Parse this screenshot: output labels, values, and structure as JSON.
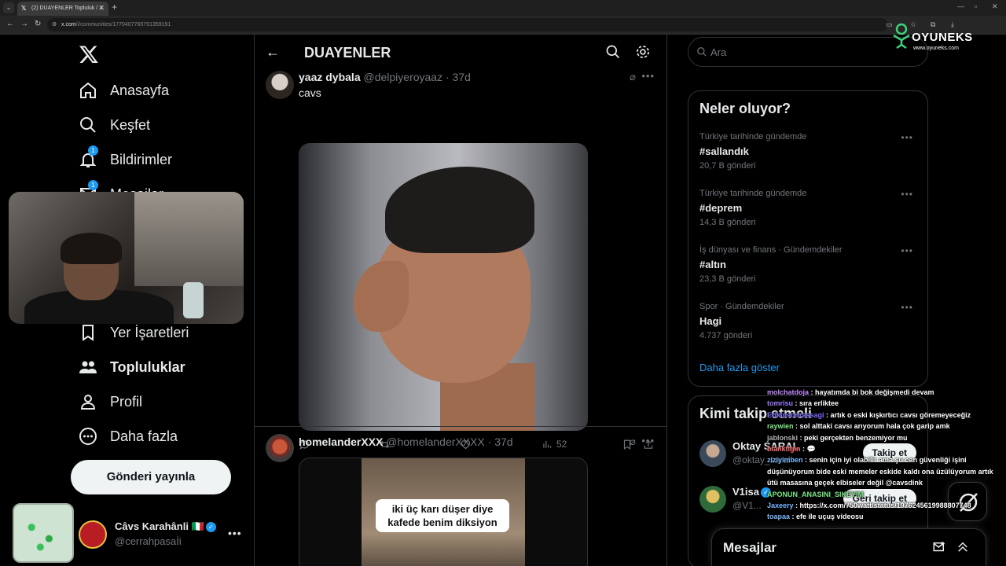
{
  "browser": {
    "tab_title": "(2) DUAYENLER Topluluk / X",
    "url_host": "x.com",
    "url_path": "/i/communities/1770407765791359191"
  },
  "nav": {
    "items": [
      {
        "label": "Anasayfa",
        "icon": "home-icon"
      },
      {
        "label": "Keşfet",
        "icon": "search-icon"
      },
      {
        "label": "Bildirimler",
        "icon": "bell-icon",
        "badge": "1"
      },
      {
        "label": "Mesajlar",
        "icon": "mail-icon",
        "badge": "1"
      },
      {
        "label": "Yer İşaretleri",
        "icon": "bookmark-icon"
      },
      {
        "label": "Topluluklar",
        "icon": "people-icon"
      },
      {
        "label": "Profil",
        "icon": "person-icon"
      },
      {
        "label": "Daha fazla",
        "icon": "more-circle-icon"
      }
    ],
    "post_button": "Gönderi yayınla"
  },
  "account": {
    "name": "Câvs Karahânli 🇮🇹",
    "handle": "@cerrahpasaİi"
  },
  "community": {
    "title": "DUAYENLER"
  },
  "tweets": [
    {
      "name": "yaaz dybala",
      "handle": "@delpiyeroyaaz",
      "time": "· 37d",
      "text": "cavs",
      "views": "52"
    },
    {
      "name": "homelanderXXX",
      "handle": "@homelanderXXXX",
      "time": "· 37d",
      "media_caption": "iki üç karı düşer diye kafede benim diksiyon"
    }
  ],
  "search": {
    "placeholder": "Ara"
  },
  "trends": {
    "title": "Neler oluyor?",
    "items": [
      {
        "context": "Türkiye tarihinde gündemde",
        "tag": "#sallandık",
        "count": "20,7 B gönderi"
      },
      {
        "context": "Türkiye tarihinde gündemde",
        "tag": "#deprem",
        "count": "14,3 B gönderi"
      },
      {
        "context": "İş dünyası ve finans · Gündemdekiler",
        "tag": "#altın",
        "count": "23,3 B gönderi"
      },
      {
        "context": "Spor · Gündemdekiler",
        "tag": "Hagi",
        "count": "4.737 gönderi"
      }
    ],
    "show_more": "Daha fazla göster"
  },
  "who_to_follow": {
    "title": "Kimi takip etmeli",
    "items": [
      {
        "name": "Oktay SARAL",
        "handle": "@oktay_saral",
        "button": "Takip et"
      },
      {
        "name": "V1isa",
        "handle": "@V1...",
        "button": "Geri takip et"
      }
    ]
  },
  "messages": {
    "title": "Mesajlar"
  },
  "overlay": {
    "brand": "OYUNEKS",
    "brand_url": "www.oyuneks.com",
    "chat": [
      {
        "user": "molchatdoja",
        "color": "#c58cff",
        "text": ": hayatımda bi bok değişmedi devam"
      },
      {
        "user": "tomrisu",
        "color": "#9b7cff",
        "text": ": sıra erliktee"
      },
      {
        "user": "Erikinsonrassagi",
        "color": "#7a6cff",
        "text": ": artık o eski kışkırtıcı cavsı göremeyeceğiz"
      },
      {
        "user": "raywien",
        "color": "#7ee787",
        "text": ": sol alttaki cavsı arıyorum hala çok garip amk"
      },
      {
        "user": "jablonski",
        "color": "#b0b0b0",
        "text": ": peki gerçekten benzemiyor mu"
      },
      {
        "user": "blanktigin",
        "color": "#ff6b6b",
        "text": ": 💬"
      },
      {
        "user": "ziziyimben",
        "color": "#7ab8ff",
        "text": ": senin için iyi olabilir ama şu can güvenliği işini düşünüyorum bide eski memeler eskide kaldı ona üzülüyorum artık ütü masasına geçek elbiseler değil @cavsdink"
      },
      {
        "user": "APONUN_ANASINI_SIKEYIM",
        "color": "#7ee787",
        "text": ""
      },
      {
        "user": "Jaxeery",
        "color": "#7ab8ff",
        "text": ": https://x.com/750watt/status/1976245619988807748"
      },
      {
        "user": "toapaa",
        "color": "#7ab8ff",
        "text": ": efe ile uçuş videosu"
      }
    ]
  }
}
